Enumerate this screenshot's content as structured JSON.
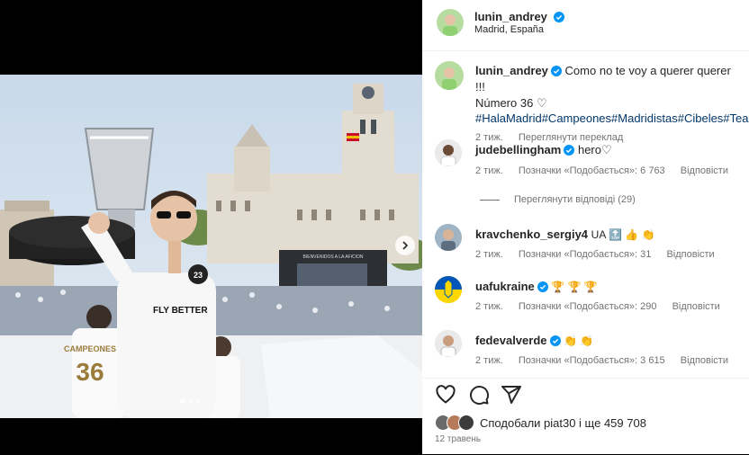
{
  "post": {
    "author": "lunin_andrey",
    "location": "Madrid, España",
    "caption_text": "Como no te voy a querer querer !!!",
    "caption_line2": "Número 36",
    "caption_heart": "♡",
    "hashtags": "#HalaMadrid#Campeones#Madridistas#Cibeles#Team",
    "caption_time": "2 тиж.",
    "translate_label": "Переглянути переклад",
    "photo": {
      "banner_text": "BIENVENIDOS A LA AFICION",
      "shirt_text": "FLY BETTER",
      "back_text": "CAMPEONES",
      "back_number": "36",
      "badge_text": "23"
    }
  },
  "comments": [
    {
      "user": "judebellingham",
      "text": "hero♡",
      "time": "2 тиж.",
      "likes": "Позначки «Подобається»: 6 763",
      "reply": "Відповісти",
      "verified": true
    },
    {
      "user": "kravchenko_sergiy4",
      "text": "UA 🔝 👍 👏",
      "time": "2 тиж.",
      "likes": "Позначки «Подобається»: 31",
      "reply": "Відповісти",
      "verified": false
    },
    {
      "user": "uafukraine",
      "text": "🏆 🏆 🏆",
      "time": "2 тиж.",
      "likes": "Позначки «Подобається»: 290",
      "reply": "Відповісти",
      "verified": true
    },
    {
      "user": "fedevalverde",
      "text": "👏 👏",
      "time": "2 тиж.",
      "likes": "Позначки «Подобається»: 3 615",
      "reply": "Відповісти",
      "verified": true
    }
  ],
  "view_replies": "Переглянути відповіді (29)",
  "footer": {
    "likes_text": "Сподобали piat30 і ще 459 708",
    "date": "12 травень"
  },
  "colors": {
    "verified": "#0095f6",
    "link": "#00376b",
    "muted": "#737373"
  },
  "icons": [
    "heart-icon",
    "comment-icon",
    "share-icon",
    "verified-icon",
    "chevron-right-icon"
  ]
}
